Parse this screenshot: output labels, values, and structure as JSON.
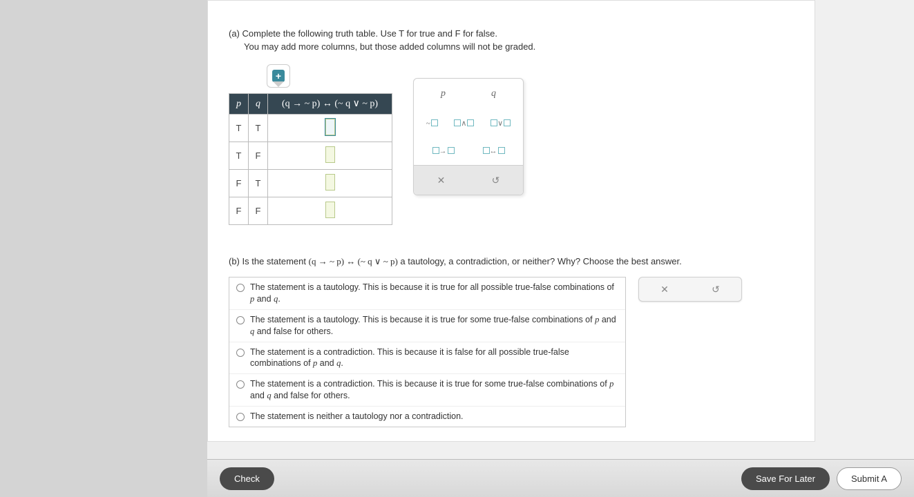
{
  "partA": {
    "label": "(a)",
    "instruction": "Complete the following truth table. Use T for true and F for false.",
    "sub": "You may add more columns, but those added columns will not be graded.",
    "headers": {
      "p": "p",
      "q": "q",
      "expr": "(q → ~ p) ↔ (~ q ∨ ~ p)"
    },
    "rows": [
      {
        "p": "T",
        "q": "T"
      },
      {
        "p": "T",
        "q": "F"
      },
      {
        "p": "F",
        "q": "T"
      },
      {
        "p": "F",
        "q": "F"
      }
    ]
  },
  "palette": {
    "p": "p",
    "q": "q",
    "not": "~",
    "and": "∧",
    "or": "∨",
    "cond": "→",
    "bicond": "↔",
    "close": "✕",
    "reset": "↺"
  },
  "partB": {
    "label": "(b)",
    "question_pre": "Is the statement ",
    "question_expr": "(q → ~ p) ↔ (~ q ∨ ~ p)",
    "question_post": " a tautology, a contradiction, or neither? Why? Choose the best answer.",
    "options": [
      "The statement is a tautology. This is because it is true for all possible true-false combinations of p and q.",
      "The statement is a tautology. This is because it is true for some true-false combinations of p and q and false for others.",
      "The statement is a contradiction. This is because it is false for all possible true-false combinations of p and q.",
      "The statement is a contradiction. This is because it is true for some true-false combinations of p and q and false for others.",
      "The statement is neither a tautology nor a contradiction."
    ],
    "reset": {
      "close": "✕",
      "undo": "↺"
    }
  },
  "footer": {
    "check": "Check",
    "save": "Save For Later",
    "submit": "Submit A"
  }
}
